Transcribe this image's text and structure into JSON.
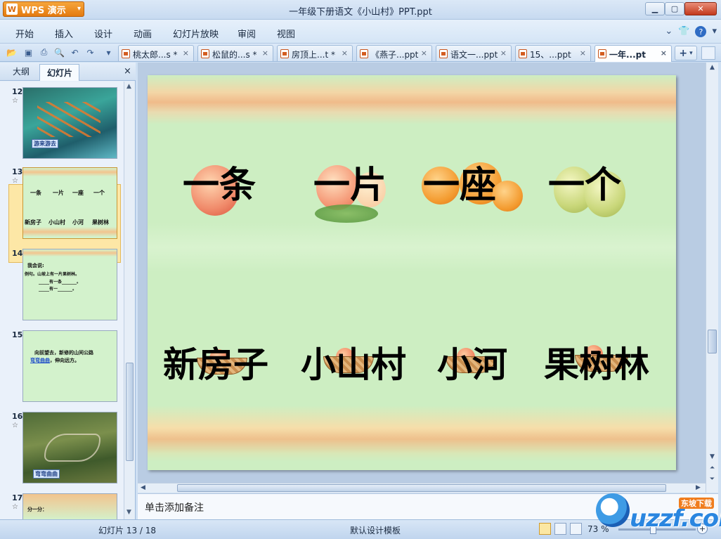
{
  "window": {
    "app_button": "WPS 演示",
    "title": "一年级下册语文《小山村》PPT.ppt",
    "controls": [
      "minimize",
      "maximize",
      "close"
    ]
  },
  "menu": {
    "items": [
      "开始",
      "插入",
      "设计",
      "动画",
      "幻灯片放映",
      "审阅",
      "视图"
    ]
  },
  "tabs": [
    {
      "label": "桃太郎...s *",
      "active": false
    },
    {
      "label": "松鼠的...s *",
      "active": false
    },
    {
      "label": "房顶上...t *",
      "active": false
    },
    {
      "label": "《燕子...ppt",
      "active": false
    },
    {
      "label": "语文一...ppt",
      "active": false
    },
    {
      "label": "15、...ppt",
      "active": false
    },
    {
      "label": "一年...pt",
      "active": true
    }
  ],
  "left_pane": {
    "tab_outline": "大纲",
    "tab_slides": "幻灯片",
    "close": "×",
    "thumbnails": [
      {
        "number": "12",
        "caption": "游来游去"
      },
      {
        "number": "13",
        "row1": [
          "一条",
          "一片",
          "一座",
          "一个"
        ],
        "row2": [
          "新房子",
          "小山村",
          "小河",
          "果树林"
        ]
      },
      {
        "number": "14",
        "line1": "我会说:",
        "line2": "例句。山坡上有一片果树林。",
        "line3": "_____有一条_______。",
        "line4": "_____有一_______。"
      },
      {
        "number": "15",
        "text": "向前望去，新修的山间公路",
        "link": "弯弯曲曲",
        "text2": "，伸向远方。"
      },
      {
        "number": "16",
        "caption": "弯弯曲曲"
      },
      {
        "number": "17",
        "caption": "分一分："
      }
    ]
  },
  "slide": {
    "row1": [
      "一条",
      "一片",
      "一座",
      "一个"
    ],
    "row2": [
      "新房子",
      "小山村",
      "小河",
      "果树林"
    ]
  },
  "notes_placeholder": "单击添加备注",
  "status": {
    "slide_counter": "幻灯片 13 / 18",
    "template": "默认设计模板",
    "zoom": "73 %"
  },
  "watermark": {
    "text": "uzzf.com",
    "badge": "东坡下载"
  },
  "colors": {
    "slide_bg": "#cdeec2",
    "wps_orange": "#e47a10",
    "selected_thumb": "#fde7a6"
  }
}
